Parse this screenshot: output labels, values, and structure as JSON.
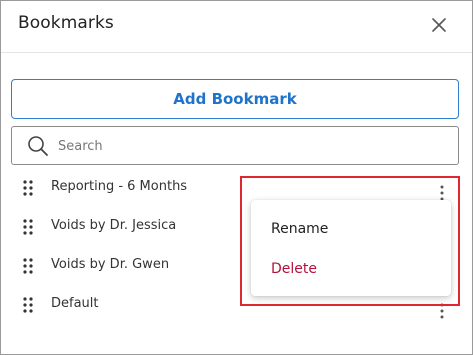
{
  "header": {
    "title": "Bookmarks"
  },
  "actions": {
    "add_label": "Add Bookmark"
  },
  "search": {
    "placeholder": "Search",
    "value": ""
  },
  "bookmarks": [
    {
      "label": "Reporting - 6 Months"
    },
    {
      "label": "Voids by Dr. Jessica"
    },
    {
      "label": "Voids by Dr. Gwen"
    },
    {
      "label": "Default"
    }
  ],
  "context_menu": {
    "rename_label": "Rename",
    "delete_label": "Delete"
  },
  "colors": {
    "accent": "#1f73c9",
    "danger": "#b5123b",
    "highlight": "#e0262e"
  },
  "icons": {
    "close": "close-icon",
    "search": "search-icon",
    "drag": "drag-handle-icon",
    "more": "more-vertical-icon"
  }
}
